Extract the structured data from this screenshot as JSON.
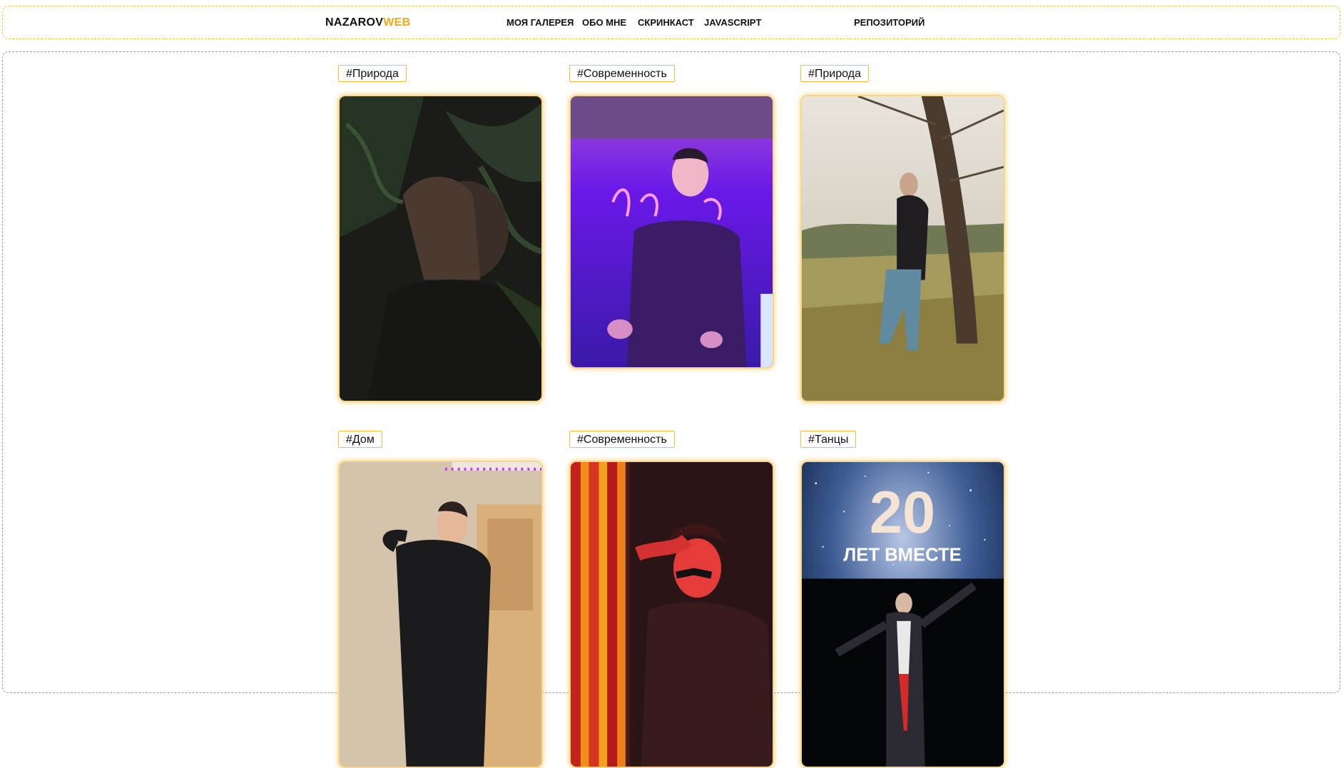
{
  "header": {
    "logo_main": "NAZAROV",
    "logo_accent": "WEB",
    "nav": {
      "gallery": "МОЯ ГАЛЕРЕЯ",
      "about": "ОБО МНЕ",
      "screencast": "СКРИНКАСТ",
      "javascript": "JAVASCRIPT",
      "repository": "РЕПОЗИТОРИЙ"
    }
  },
  "gallery": {
    "cards": [
      {
        "tag": "#Природа"
      },
      {
        "tag": "#Современность"
      },
      {
        "tag": "#Природа"
      },
      {
        "tag": "#Дом"
      },
      {
        "tag": "#Современность"
      },
      {
        "tag": "#Танцы"
      }
    ],
    "dance_photo_sign": {
      "number": "20",
      "text": "ЛЕТ ВМЕСТЕ"
    }
  },
  "colors": {
    "accent": "#f3a817",
    "border_accent": "#f3bf3c",
    "photo_glow": "#f7d58b"
  }
}
